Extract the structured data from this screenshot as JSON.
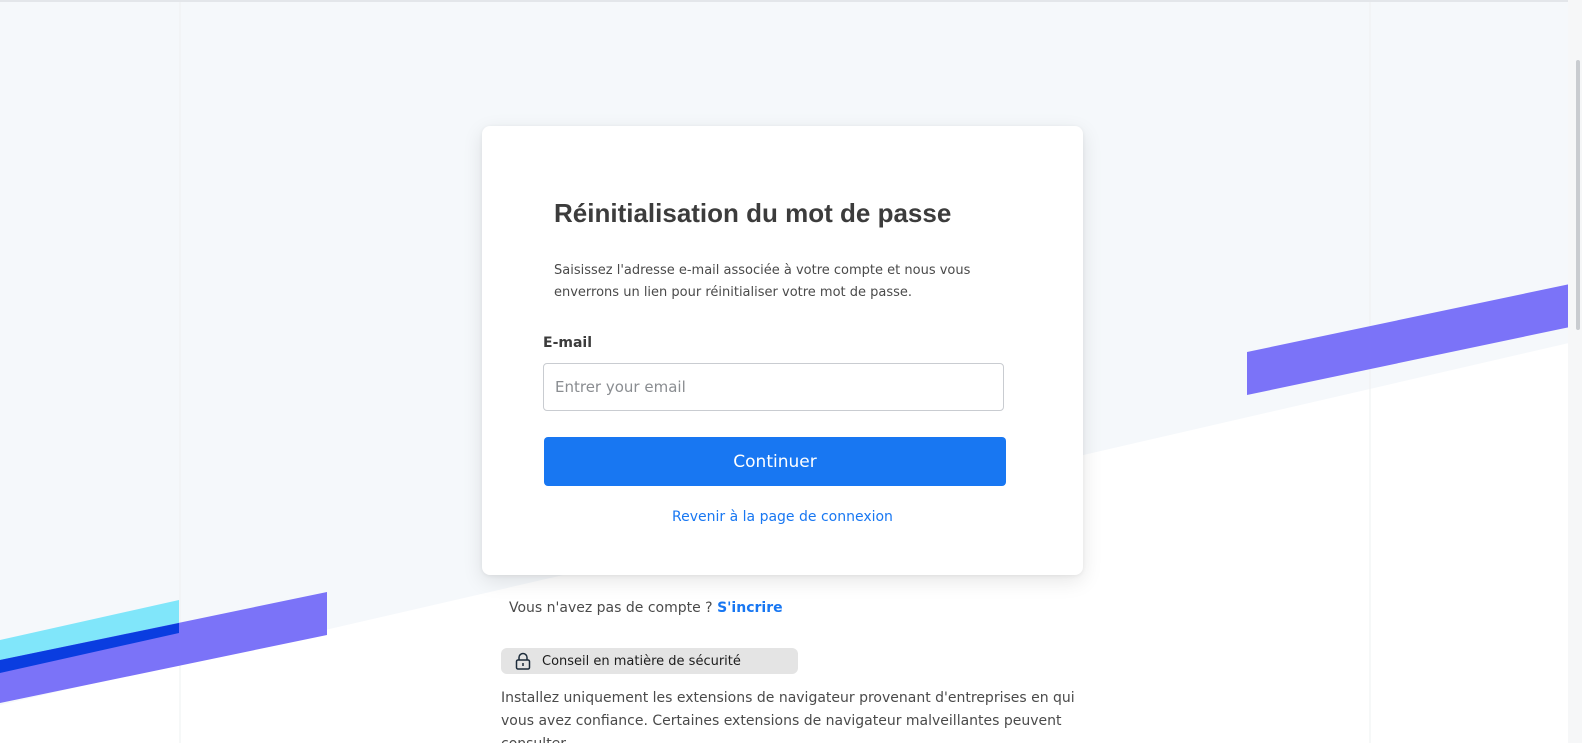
{
  "reset": {
    "title": "Réinitialisation du mot de passe",
    "description": "Saisissez l'adresse e-mail associée à votre compte et nous vous enverrons un lien pour réinitialiser votre mot de passe.",
    "email_label": "E-mail",
    "email_placeholder": "Entrer your email",
    "email_value": "",
    "continue_label": "Continuer",
    "back_link_label": "Revenir à la page de connexion"
  },
  "signup": {
    "prompt": "Vous n'avez pas de compte ? ",
    "link_label": "S'incrire"
  },
  "security": {
    "icon": "lock-icon",
    "badge_label": "Conseil en matière de sécurité",
    "body": "Installez uniquement les extensions de navigateur provenant d'entreprises en qui vous avez confiance. Certaines extensions de navigateur malveillantes peuvent consulter"
  },
  "colors": {
    "accent": "#1877f2",
    "stripe_purple": "#7b73f8",
    "stripe_cyan": "#80e6fa",
    "stripe_blue": "#0a3de0",
    "background_tint": "#f5f8fb"
  }
}
